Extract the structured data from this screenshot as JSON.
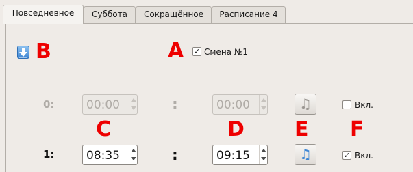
{
  "tabs": [
    {
      "label": "Повседневное",
      "active": true
    },
    {
      "label": "Суббота",
      "active": false
    },
    {
      "label": "Сокращённое",
      "active": false
    },
    {
      "label": "Расписание 4",
      "active": false
    }
  ],
  "annotations": {
    "a": "A",
    "b": "B",
    "c": "C",
    "d": "D",
    "e": "E",
    "f": "F"
  },
  "shift": {
    "label": "Смена №1",
    "checked": true,
    "mark": "✓"
  },
  "rows": [
    {
      "number": "0:",
      "start": "00:00",
      "end": "00:00",
      "separator": ":",
      "enabled_label": "Вкл.",
      "enabled": false,
      "mark": ""
    },
    {
      "number": "1:",
      "start": "08:35",
      "end": "09:15",
      "separator": ":",
      "enabled_label": "Вкл.",
      "enabled": true,
      "mark": "✓"
    }
  ],
  "icons": {
    "move_down": "arrow-down-icon",
    "sound": "music-note-icon"
  },
  "colors": {
    "annotation": "#ee0000",
    "accent": "#3e86d4",
    "disabled_text": "#b0aca7"
  }
}
